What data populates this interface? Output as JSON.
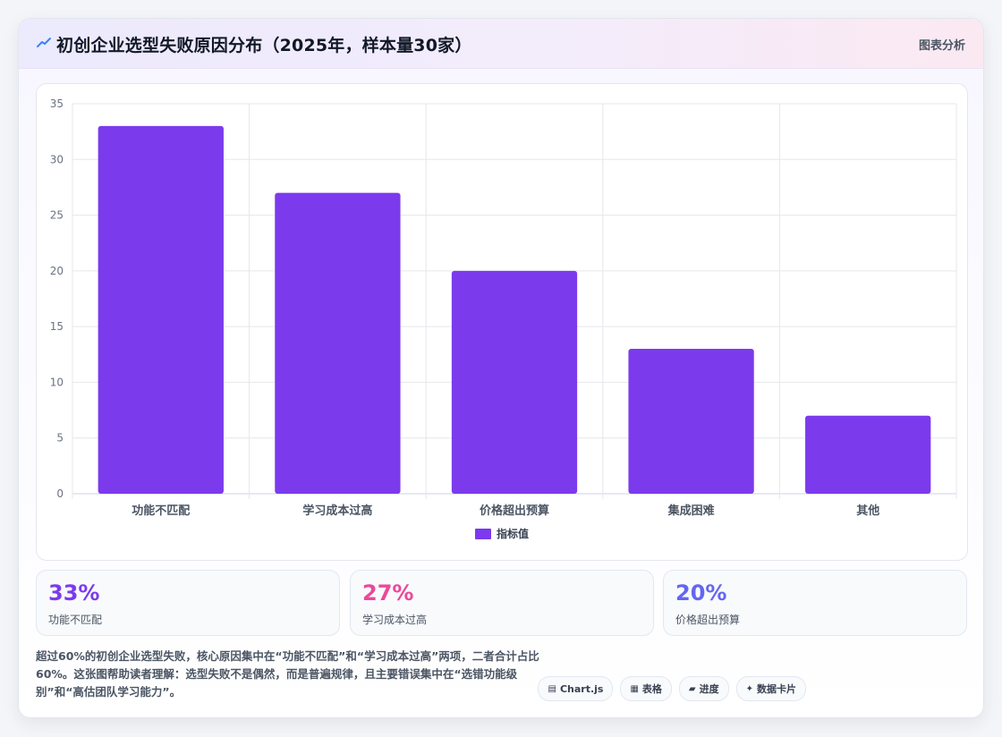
{
  "header": {
    "title": "初创企业选型失败原因分布（2025年，样本量30家）",
    "meta": "图表分析",
    "icon": "trend-icon"
  },
  "chart_data": {
    "type": "bar",
    "categories": [
      "功能不匹配",
      "学习成本过高",
      "价格超出预算",
      "集成困难",
      "其他"
    ],
    "series": [
      {
        "name": "指标值",
        "values": [
          33,
          27,
          20,
          13,
          7
        ],
        "color": "#7c3aed"
      }
    ],
    "ylim": [
      0,
      35
    ],
    "yticks": [
      0,
      5,
      10,
      15,
      20,
      25,
      30,
      35
    ],
    "grid": true,
    "legend": "bottom",
    "title": "",
    "xlabel": "",
    "ylabel": ""
  },
  "stats": [
    {
      "value": "33%",
      "label": "功能不匹配",
      "color": "#7c3aed"
    },
    {
      "value": "27%",
      "label": "学习成本过高",
      "color": "#ec4899"
    },
    {
      "value": "20%",
      "label": "价格超出预算",
      "color": "#6366f1"
    }
  ],
  "note": "超过60%的初创企业选型失败，核心原因集中在“功能不匹配”和“学习成本过高”两项，二者合计占比60%。这张图帮助读者理解：选型失败不是偶然，而是普遍规律，且主要错误集中在“选错功能级别”和“高估团队学习能力”。",
  "tags": [
    {
      "icon": "chart-icon",
      "glyph": "▤",
      "label": "Chart.js"
    },
    {
      "icon": "table-icon",
      "glyph": "▦",
      "label": "表格"
    },
    {
      "icon": "progress-icon",
      "glyph": "▰",
      "label": "进度"
    },
    {
      "icon": "sparkle-icon",
      "glyph": "✦",
      "label": "数据卡片"
    }
  ]
}
